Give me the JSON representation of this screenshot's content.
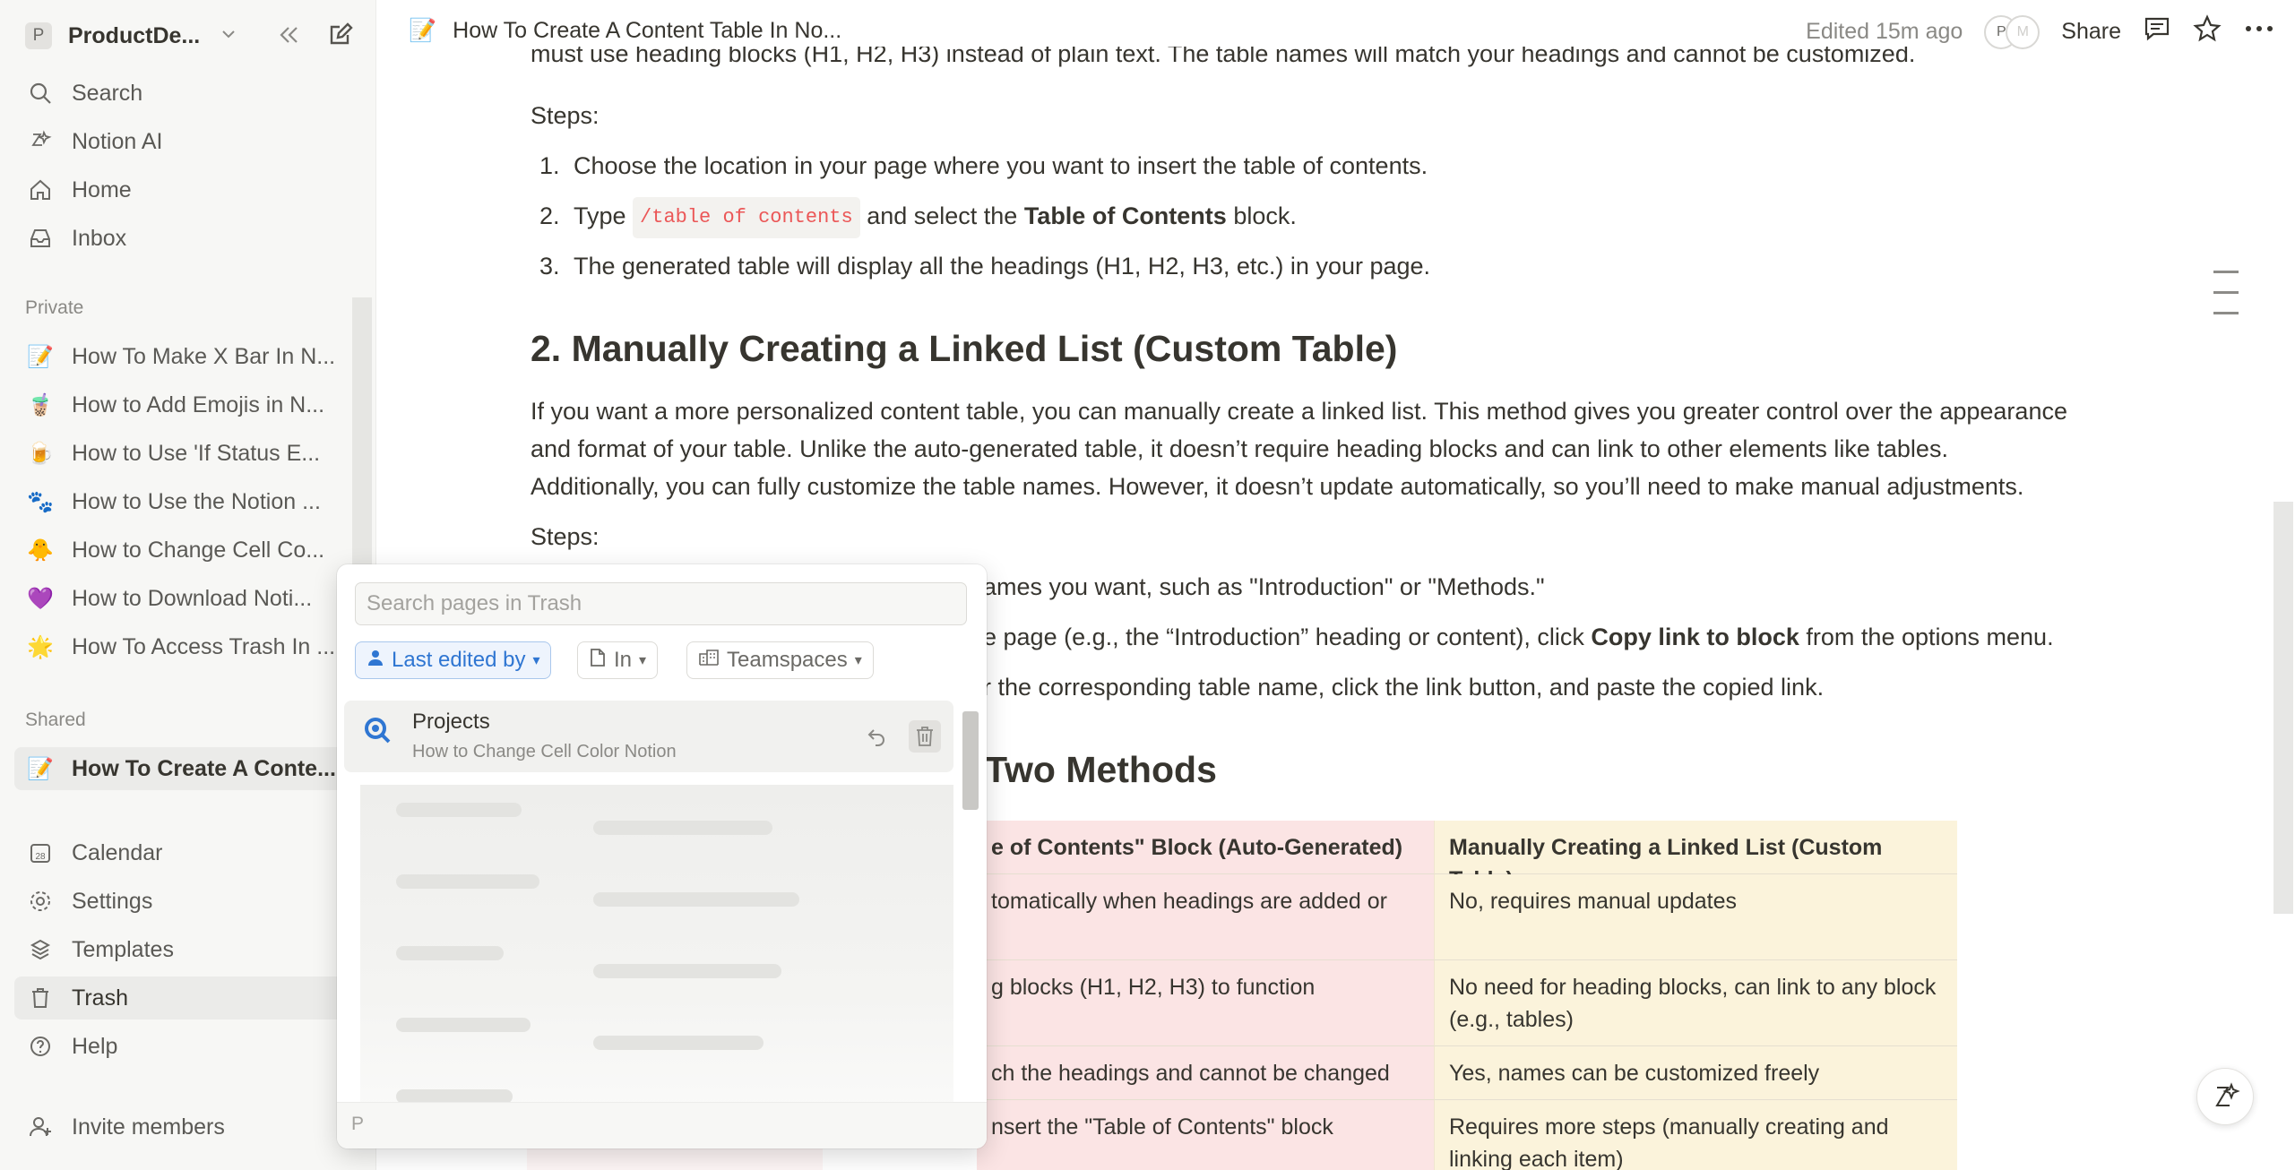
{
  "sidebar": {
    "workspace": {
      "avatar": "P",
      "name": "ProductDe..."
    },
    "top_items": [
      {
        "label": "Search",
        "icon": "search-icon"
      },
      {
        "label": "Notion AI",
        "icon": "notion-ai-icon"
      },
      {
        "label": "Home",
        "icon": "home-icon"
      },
      {
        "label": "Inbox",
        "icon": "inbox-icon"
      }
    ],
    "private_label": "Private",
    "private_pages": [
      {
        "emoji": "📝",
        "label": "How To Make X Bar In N..."
      },
      {
        "emoji": "🧋",
        "label": "How to Add Emojis in N..."
      },
      {
        "emoji": "🍺",
        "label": "How to Use 'If Status E..."
      },
      {
        "emoji": "🐾",
        "label": "How to Use the Notion ..."
      },
      {
        "emoji": "🐥",
        "label": "How to Change Cell Co..."
      },
      {
        "emoji": "💜",
        "label": "How to Download Noti..."
      },
      {
        "emoji": "🌟",
        "label": "How To Access Trash In ..."
      }
    ],
    "shared_label": "Shared",
    "shared_pages": [
      {
        "emoji": "📝",
        "label": "How To Create A Conte..."
      }
    ],
    "bottom_items": [
      {
        "label": "Calendar",
        "icon": "calendar-icon",
        "badge": "28"
      },
      {
        "label": "Settings",
        "icon": "gear-icon"
      },
      {
        "label": "Templates",
        "icon": "templates-icon"
      },
      {
        "label": "Trash",
        "icon": "trash-icon"
      },
      {
        "label": "Help",
        "icon": "help-icon"
      }
    ],
    "invite": "Invite members"
  },
  "topbar": {
    "emoji": "📝",
    "breadcrumb": "How To Create A Content Table In No...",
    "edited": "Edited 15m ago",
    "avatars": [
      "P",
      "M"
    ],
    "share": "Share"
  },
  "content": {
    "cut_line": "must use heading blocks (H1, H2, H3) instead of plain text. The table names will match your headings and cannot be customized.",
    "steps_label": "Steps:",
    "steps1": [
      {
        "n": "1.",
        "text": "Choose the location in your page where you want to insert the table of contents."
      },
      {
        "n": "2.",
        "pre": "Type ",
        "code": "/table of contents",
        "mid": " and select the ",
        "bold": "Table of Contents",
        "post": " block."
      },
      {
        "n": "3.",
        "text": "The generated table will display all the headings (H1, H2, H3, etc.) in your page."
      }
    ],
    "heading2": "2. Manually Creating a Linked List (Custom Table)",
    "paragraph": [
      "If you want a more personalized content table, you can manually create a linked list. This method gives you greater control over the appearance",
      "and format of your table. Unlike the auto-generated table, it doesn’t require heading blocks and can link to other elements like tables.",
      "Additionally, you can fully customize the table names. However, it doesn’t update automatically, so you’ll need to make manual adjustments."
    ],
    "steps2_label": "Steps:",
    "steps2": [
      "ames you want, such as \"Introduction\" or \"Methods.\"",
      {
        "pre": "e page (e.g., the “Introduction” heading or content), click ",
        "bold": "Copy link to block",
        "post": " from the options menu."
      },
      "r the corresponding table name, click the link button, and paste the copied link."
    ],
    "heading3": "Two Methods",
    "table": {
      "headers": [
        "e of Contents\" Block (Auto-Generated)",
        "Manually Creating a Linked List (Custom Table)"
      ],
      "rows": [
        [
          "tomatically when headings are added or",
          "No, requires manual updates"
        ],
        [
          "g blocks (H1, H2, H3) to function",
          "No need for heading blocks, can link to any block (e.g., tables)"
        ],
        [
          "ch the headings and cannot be changed",
          "Yes, names can be customized freely"
        ],
        [
          "nsert the \"Table of Contents\" block",
          "Requires more steps (manually creating and linking each item)"
        ]
      ]
    }
  },
  "trash_popup": {
    "search_placeholder": "Search pages in Trash",
    "filters": [
      {
        "label": "Last edited by",
        "icon": "person-icon",
        "active": true
      },
      {
        "label": "In",
        "icon": "page-icon",
        "active": false
      },
      {
        "label": "Teamspaces",
        "icon": "teamspace-icon",
        "active": false
      }
    ],
    "item": {
      "title": "Projects",
      "subtitle": "How to Change Cell Color Notion"
    },
    "footer": "P"
  },
  "colors": {
    "accent": "#2f76d2",
    "table_col1": "#fbe4e4",
    "table_col2": "#fbf3db",
    "code_text": "#eb5757"
  }
}
